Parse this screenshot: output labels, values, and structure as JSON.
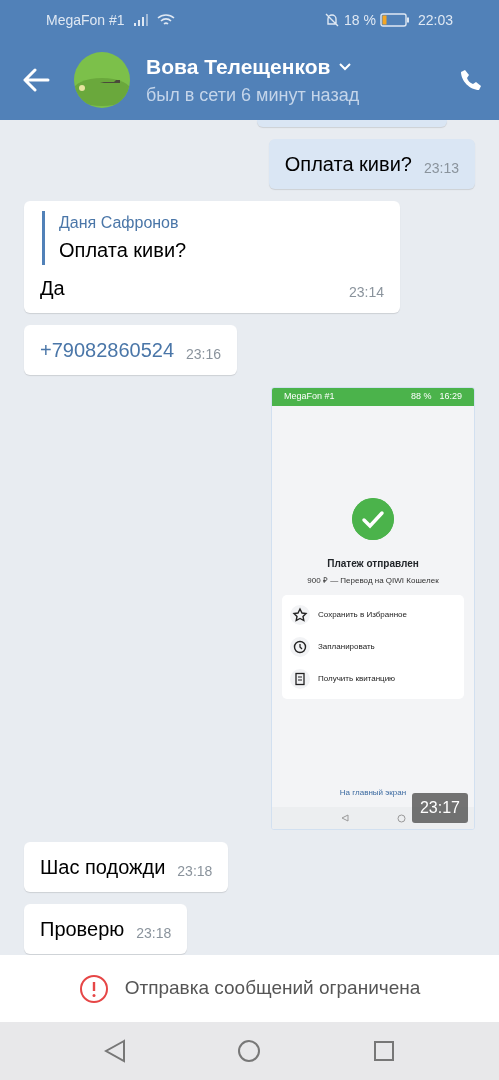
{
  "status_bar": {
    "carrier": "MegaFon #1",
    "battery_percent": "18 %",
    "time": "22:03"
  },
  "header": {
    "name": "Вова Телещенков",
    "last_seen": "был в сети 6 минут назад"
  },
  "messages": [
    {
      "kind": "cut",
      "outgoing": true
    },
    {
      "kind": "text",
      "outgoing": true,
      "text": "Оплата киви?",
      "time": "23:13"
    },
    {
      "kind": "reply",
      "outgoing": false,
      "quote_author": "Даня Сафронов",
      "quote_text": "Оплата киви?",
      "text": "Да",
      "time": "23:14"
    },
    {
      "kind": "link",
      "outgoing": false,
      "text": "+79082860524",
      "time": "23:16"
    },
    {
      "kind": "screenshot",
      "outgoing": true,
      "time": "23:17",
      "shot": {
        "carrier": "MegaFon #1",
        "battery_percent": "88 %",
        "time": "16:29",
        "title": "Платеж отправлен",
        "subtitle": "900 ₽ — Перевод на QIWI Кошелек",
        "actions": [
          {
            "kind": "favorite",
            "label": "Сохранить в Избранное"
          },
          {
            "kind": "schedule",
            "label": "Запланировать"
          },
          {
            "kind": "receipt",
            "label": "Получить квитанцию"
          }
        ],
        "home_link": "На главный экран"
      }
    },
    {
      "kind": "text",
      "outgoing": false,
      "text": "Шас подожди",
      "time": "23:18"
    },
    {
      "kind": "text",
      "outgoing": false,
      "text": "Проверю",
      "time": "23:18"
    }
  ],
  "restriction": {
    "text": "Отправка сообщений ограничена"
  }
}
